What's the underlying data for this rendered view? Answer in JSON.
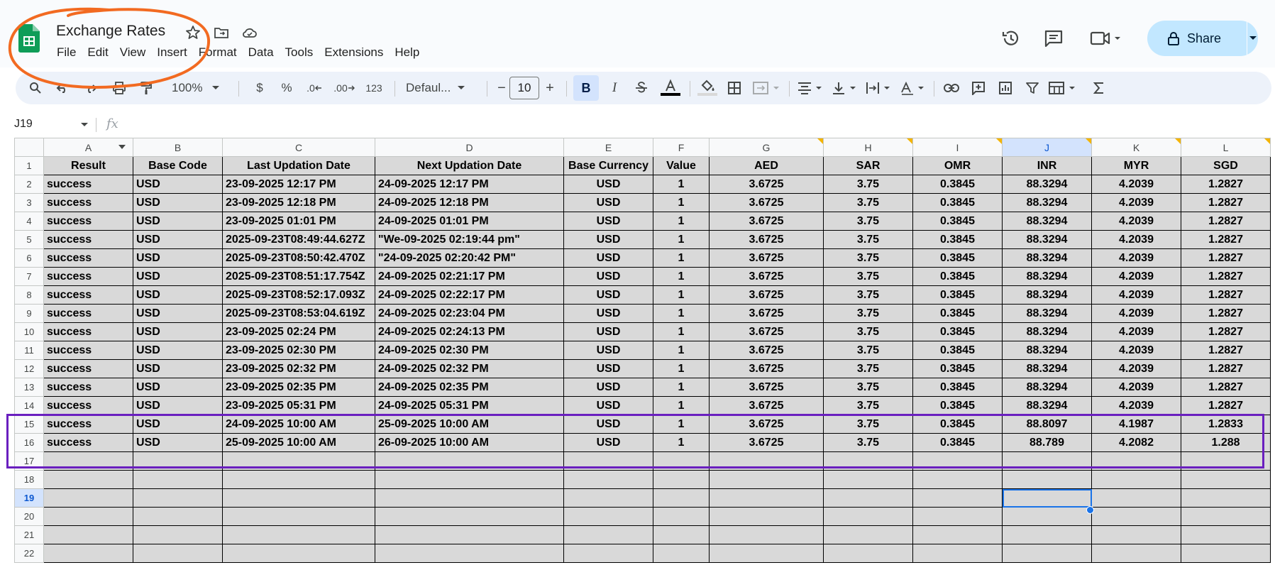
{
  "app": {
    "title": "Exchange Rates",
    "menu": [
      "File",
      "Edit",
      "View",
      "Insert",
      "Format",
      "Data",
      "Tools",
      "Extensions",
      "Help"
    ],
    "share_label": "Share"
  },
  "toolbar": {
    "zoom": "100%",
    "currency": "$",
    "percent": "%",
    "dec_decrease": ".0",
    "dec_increase": ".00",
    "number_format": "123",
    "font": "Defaul...",
    "font_size": "10",
    "bold": "B",
    "italic": "I",
    "minus": "−",
    "plus": "+"
  },
  "formula_bar": {
    "cell_ref": "J19",
    "fx": "fx",
    "value": ""
  },
  "sheet": {
    "columns": [
      "A",
      "B",
      "C",
      "D",
      "E",
      "F",
      "G",
      "H",
      "I",
      "J",
      "K",
      "L"
    ],
    "selected_column": "J",
    "selected_row": "19",
    "header": [
      "Result",
      "Base Code",
      "Last Updation Date",
      "Next Updation Date",
      "Base Currency",
      "Value",
      "AED",
      "SAR",
      "OMR",
      "INR",
      "MYR",
      "SGD"
    ],
    "rows": [
      [
        "success",
        "USD",
        "23-09-2025 12:17 PM",
        "24-09-2025 12:17 PM",
        "USD",
        "1",
        "3.6725",
        "3.75",
        "0.3845",
        "88.3294",
        "4.2039",
        "1.2827"
      ],
      [
        "success",
        "USD",
        "23-09-2025 12:18 PM",
        "24-09-2025 12:18 PM",
        "USD",
        "1",
        "3.6725",
        "3.75",
        "0.3845",
        "88.3294",
        "4.2039",
        "1.2827"
      ],
      [
        "success",
        "USD",
        "23-09-2025 01:01 PM",
        "24-09-2025 01:01 PM",
        "USD",
        "1",
        "3.6725",
        "3.75",
        "0.3845",
        "88.3294",
        "4.2039",
        "1.2827"
      ],
      [
        "success",
        "USD",
        "2025-09-23T08:49:44.627Z",
        "\"We-09-2025 02:19:44 pm\"",
        "USD",
        "1",
        "3.6725",
        "3.75",
        "0.3845",
        "88.3294",
        "4.2039",
        "1.2827"
      ],
      [
        "success",
        "USD",
        "2025-09-23T08:50:42.470Z",
        "\"24-09-2025 02:20:42 PM\"",
        "USD",
        "1",
        "3.6725",
        "3.75",
        "0.3845",
        "88.3294",
        "4.2039",
        "1.2827"
      ],
      [
        "success",
        "USD",
        "2025-09-23T08:51:17.754Z",
        "24-09-2025 02:21:17 PM",
        "USD",
        "1",
        "3.6725",
        "3.75",
        "0.3845",
        "88.3294",
        "4.2039",
        "1.2827"
      ],
      [
        "success",
        "USD",
        "2025-09-23T08:52:17.093Z",
        "24-09-2025 02:22:17 PM",
        "USD",
        "1",
        "3.6725",
        "3.75",
        "0.3845",
        "88.3294",
        "4.2039",
        "1.2827"
      ],
      [
        "success",
        "USD",
        "2025-09-23T08:53:04.619Z",
        "24-09-2025 02:23:04 PM",
        "USD",
        "1",
        "3.6725",
        "3.75",
        "0.3845",
        "88.3294",
        "4.2039",
        "1.2827"
      ],
      [
        "success",
        "USD",
        "23-09-2025 02:24 PM",
        "24-09-2025 02:24:13 PM",
        "USD",
        "1",
        "3.6725",
        "3.75",
        "0.3845",
        "88.3294",
        "4.2039",
        "1.2827"
      ],
      [
        "success",
        "USD",
        "23-09-2025 02:30 PM",
        "24-09-2025 02:30 PM",
        "USD",
        "1",
        "3.6725",
        "3.75",
        "0.3845",
        "88.3294",
        "4.2039",
        "1.2827"
      ],
      [
        "success",
        "USD",
        "23-09-2025 02:32 PM",
        "24-09-2025 02:32 PM",
        "USD",
        "1",
        "3.6725",
        "3.75",
        "0.3845",
        "88.3294",
        "4.2039",
        "1.2827"
      ],
      [
        "success",
        "USD",
        "23-09-2025 02:35 PM",
        "24-09-2025 02:35 PM",
        "USD",
        "1",
        "3.6725",
        "3.75",
        "0.3845",
        "88.3294",
        "4.2039",
        "1.2827"
      ],
      [
        "success",
        "USD",
        "23-09-2025 05:31 PM",
        "24-09-2025 05:31 PM",
        "USD",
        "1",
        "3.6725",
        "3.75",
        "0.3845",
        "88.3294",
        "4.2039",
        "1.2827"
      ],
      [
        "success",
        "USD",
        "24-09-2025 10:00 AM",
        "25-09-2025 10:00 AM",
        "USD",
        "1",
        "3.6725",
        "3.75",
        "0.3845",
        "88.8097",
        "4.1987",
        "1.2833"
      ],
      [
        "success",
        "USD",
        "25-09-2025 10:00 AM",
        "26-09-2025 10:00 AM",
        "USD",
        "1",
        "3.6725",
        "3.75",
        "0.3845",
        "88.789",
        "4.2082",
        "1.288"
      ],
      [
        "",
        "",
        "",
        "",
        "",
        "",
        "",
        "",
        "",
        "",
        "",
        ""
      ],
      [
        "",
        "",
        "",
        "",
        "",
        "",
        "",
        "",
        "",
        "",
        "",
        ""
      ],
      [
        "",
        "",
        "",
        "",
        "",
        "",
        "",
        "",
        "",
        "",
        "",
        ""
      ],
      [
        "",
        "",
        "",
        "",
        "",
        "",
        "",
        "",
        "",
        "",
        "",
        ""
      ],
      [
        "",
        "",
        "",
        "",
        "",
        "",
        "",
        "",
        "",
        "",
        "",
        ""
      ],
      [
        "",
        "",
        "",
        "",
        "",
        "",
        "",
        "",
        "",
        "",
        "",
        ""
      ]
    ]
  },
  "colors": {
    "annotation_circle": "#f26a21",
    "annotation_rect": "#6a1fbf",
    "cell_fill": "#d9d9d9",
    "selection": "#1a73e8",
    "share_bg": "#c2e7ff"
  }
}
